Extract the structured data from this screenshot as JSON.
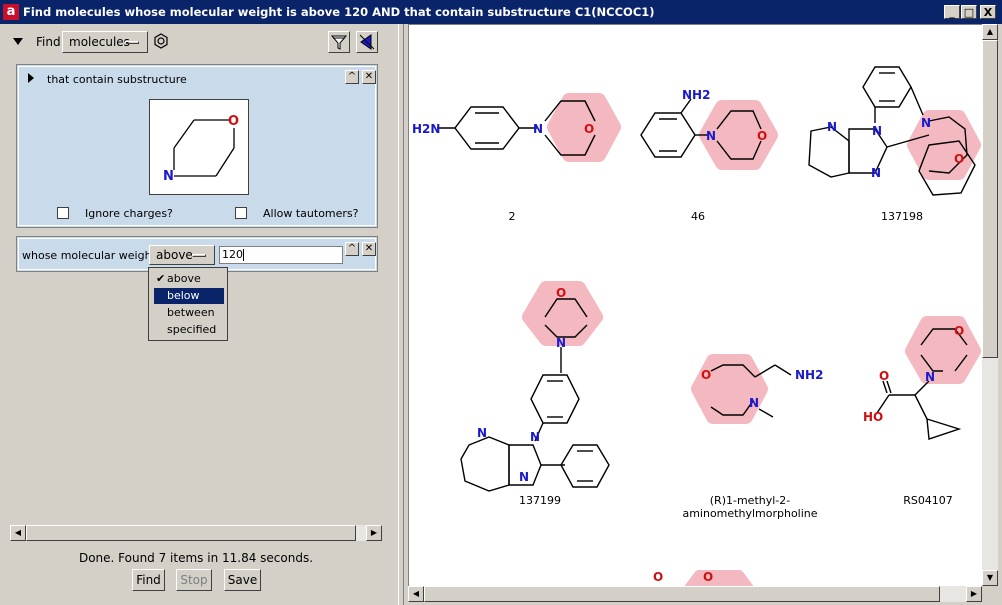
{
  "window": {
    "title": "Find molecules whose molecular weight is above 120  AND that contain substructure C1(NCCOC1)",
    "app_glyph": "a",
    "controls": {
      "minimize": "_",
      "maximize": "□",
      "close": "X"
    }
  },
  "query": {
    "find_label": "Find",
    "find_select": "molecules",
    "substructure_panel": {
      "title": "that contain substructure",
      "atoms": {
        "o": "O",
        "n": "N"
      },
      "ignore_charges": "Ignore charges?",
      "allow_tautomers": "Allow tautomers?"
    },
    "weight_panel": {
      "label": "whose molecular weight is",
      "operator": "above",
      "value": "120",
      "options": [
        "above",
        "below",
        "between",
        "specified"
      ],
      "checked_option": "above",
      "highlighted_option": "below"
    }
  },
  "status": {
    "text": "Done. Found 7 items in 11.84 seconds.",
    "find": "Find",
    "stop": "Stop",
    "save": "Save"
  },
  "results": {
    "items": [
      {
        "caption": "2"
      },
      {
        "caption": "46"
      },
      {
        "caption": "137198"
      },
      {
        "caption": "137199"
      },
      {
        "caption": "(R)1-methyl-2-aminomethylmorpholine"
      },
      {
        "caption": "RS04107"
      }
    ],
    "labels": {
      "h2n": "H2N",
      "nh2": "NH2",
      "n": "N",
      "o": "O",
      "ho": "HO"
    }
  },
  "colors": {
    "title_bg": "#0a246a",
    "panel_bg": "#c9daea",
    "highlight": "#f4b8c0",
    "nitrogen": "#1a1acc",
    "oxygen": "#d01010"
  }
}
